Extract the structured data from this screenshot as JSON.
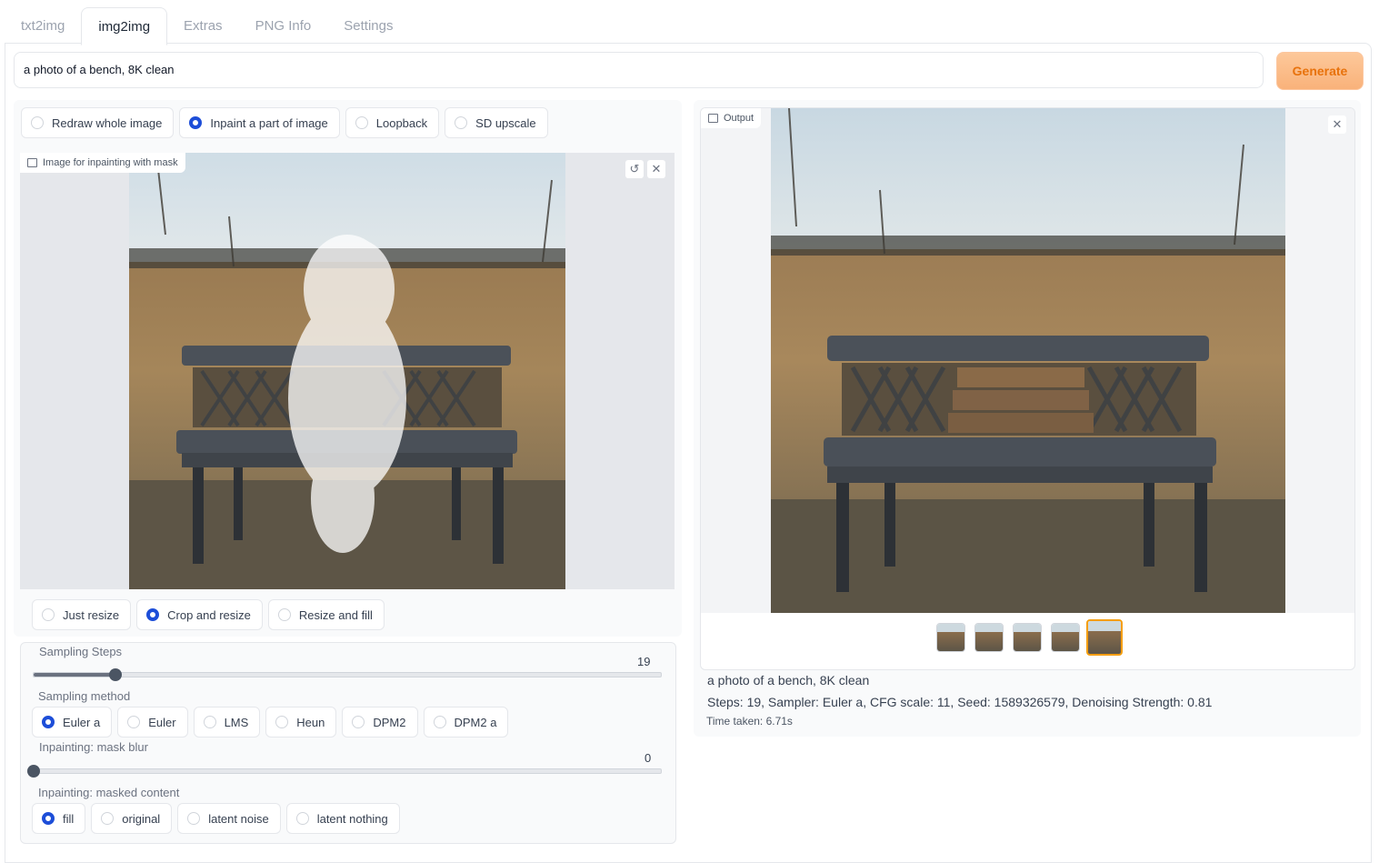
{
  "tabs": [
    {
      "label": "txt2img"
    },
    {
      "label": "img2img"
    },
    {
      "label": "Extras"
    },
    {
      "label": "PNG Info"
    },
    {
      "label": "Settings"
    }
  ],
  "active_tab": "img2img",
  "prompt": {
    "value": "a photo of a bench, 8K clean"
  },
  "generate_label": "Generate",
  "mode": {
    "options": [
      "Redraw whole image",
      "Inpaint a part of image",
      "Loopback",
      "SD upscale"
    ],
    "selected": "Inpaint a part of image"
  },
  "input_image": {
    "label": "Image for inpainting with mask"
  },
  "resize": {
    "options": [
      "Just resize",
      "Crop and resize",
      "Resize and fill"
    ],
    "selected": "Crop and resize"
  },
  "sampling_steps": {
    "label": "Sampling Steps",
    "value": "19",
    "fraction": 0.13
  },
  "sampling_method": {
    "label": "Sampling method",
    "options": [
      "Euler a",
      "Euler",
      "LMS",
      "Heun",
      "DPM2",
      "DPM2 a"
    ],
    "selected": "Euler a"
  },
  "mask_blur": {
    "label": "Inpainting: mask blur",
    "value": "0",
    "fraction": 0
  },
  "masked_content": {
    "label": "Inpainting: masked content",
    "options": [
      "fill",
      "original",
      "latent noise",
      "latent nothing"
    ],
    "selected": "fill"
  },
  "output": {
    "label": "Output",
    "prompt_text": "a photo of a bench, 8K clean",
    "params": "Steps: 19, Sampler: Euler a, CFG scale: 11, Seed: 1589326579, Denoising Strength: 0.81",
    "time_taken": "Time taken: 6.71s",
    "thumbnail_count": 5,
    "selected_thumbnail": 5
  },
  "colors": {
    "accent": "#1d4ed8",
    "generate": "#f9b27a",
    "generate_text": "#e8720c",
    "thumb_selected": "#f59e0b"
  }
}
